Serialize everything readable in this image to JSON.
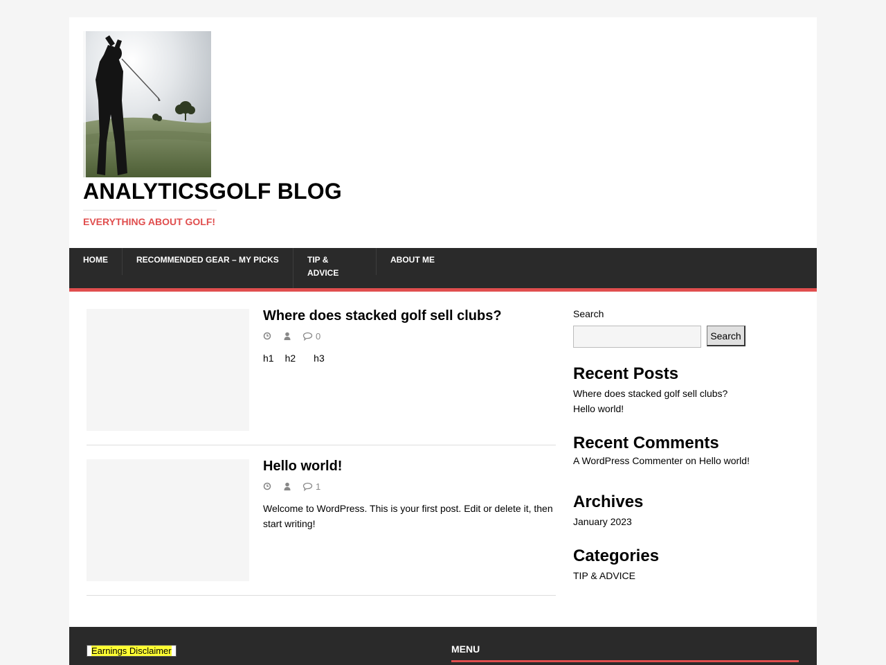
{
  "header": {
    "site_title": "ANALYTICSGOLF BLOG",
    "tagline": "EVERYTHING ABOUT GOLF!",
    "logo_icon": "golfer-photo"
  },
  "nav": {
    "items": [
      {
        "label": "HOME"
      },
      {
        "label": "RECOMMENDED GEAR – MY PICKS"
      },
      {
        "label_line1": "TIP &",
        "label_line2": "ADVICE"
      },
      {
        "label": "ABOUT ME"
      }
    ]
  },
  "posts": [
    {
      "title": "Where does stacked golf sell clubs?",
      "comment_count": "0",
      "excerpt_headings": [
        "h1",
        "h2",
        "h3"
      ]
    },
    {
      "title": "Hello world!",
      "comment_count": "1",
      "excerpt": "Welcome to WordPress. This is your first post. Edit or delete it, then start writing!"
    }
  ],
  "sidebar": {
    "search": {
      "label": "Search",
      "button": "Search",
      "value": ""
    },
    "recent_posts": {
      "title": "Recent Posts",
      "items": [
        "Where does stacked golf sell clubs?",
        "Hello world!"
      ]
    },
    "recent_comments": {
      "title": "Recent Comments",
      "author": "A WordPress Commenter",
      "on": "on",
      "post": "Hello world!"
    },
    "archives": {
      "title": "Archives",
      "items": [
        "January 2023"
      ]
    },
    "categories": {
      "title": "Categories",
      "items": [
        "TIP & ADVICE"
      ]
    }
  },
  "footer": {
    "disclaimer": "Earnings Disclaimer",
    "menu_title": "MENU"
  },
  "colors": {
    "accent": "#e04e4e",
    "nav_bg": "#2a2a2a",
    "page_bg": "#f5f5f5",
    "highlight": "#ffff33"
  }
}
